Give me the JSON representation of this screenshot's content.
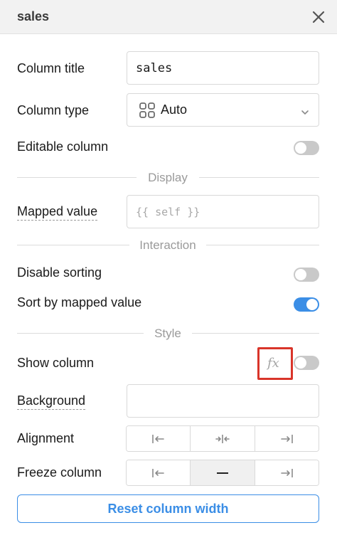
{
  "panel": {
    "title": "sales",
    "close_icon": "close-icon"
  },
  "column_title": {
    "label": "Column title",
    "value": "sales"
  },
  "column_type": {
    "label": "Column type",
    "selected": "Auto",
    "icon": "grid-icon"
  },
  "editable_column": {
    "label": "Editable column",
    "enabled": false
  },
  "sections": {
    "display": "Display",
    "interaction": "Interaction",
    "style": "Style"
  },
  "mapped_value": {
    "label": "Mapped value",
    "placeholder": "{{ self }}"
  },
  "disable_sorting": {
    "label": "Disable sorting",
    "enabled": false
  },
  "sort_by_mapped_value": {
    "label": "Sort by mapped value",
    "enabled": true
  },
  "show_column": {
    "label": "Show column",
    "fx_label": "fx",
    "enabled": false
  },
  "background": {
    "label": "Background",
    "value": ""
  },
  "alignment": {
    "label": "Alignment",
    "options": [
      "align-left-icon",
      "align-center-icon",
      "align-right-icon"
    ],
    "selected": null
  },
  "freeze_column": {
    "label": "Freeze column",
    "options": [
      "freeze-left-icon",
      "freeze-none-icon",
      "freeze-right-icon"
    ],
    "selected": 1
  },
  "reset_button": {
    "label": "Reset column width"
  },
  "colors": {
    "accent": "#3b8ee6",
    "highlight": "#d9352a",
    "toggle_off": "#c9c9c9"
  }
}
